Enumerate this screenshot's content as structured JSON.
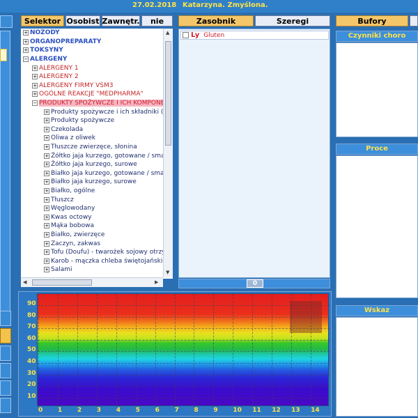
{
  "header": {
    "date": "27.02.2018",
    "user": "Katarzyna. Zmyślona."
  },
  "tabs_left": [
    {
      "label": "Selektor",
      "active": true
    },
    {
      "label": "Osobist",
      "active": false
    },
    {
      "label": "Zawnętr.",
      "active": false
    },
    {
      "label": "nie",
      "active": false
    }
  ],
  "tabs_middle": [
    {
      "label": "Zasobnik",
      "active": true
    },
    {
      "label": "Szeregi",
      "active": false
    }
  ],
  "tabs_right": [
    {
      "label": "Bufory",
      "active": true
    }
  ],
  "tree": [
    {
      "label": "NOZODY",
      "level": 0,
      "style": "blue"
    },
    {
      "label": "ORGANOPREPARATY",
      "level": 0,
      "style": "blue"
    },
    {
      "label": "TOKSYNY",
      "level": 0,
      "style": "blue"
    },
    {
      "label": "ALERGENY",
      "level": 0,
      "style": "blue",
      "expanded": true
    },
    {
      "label": "ALERGENY 1",
      "level": 1,
      "style": "red"
    },
    {
      "label": "ALERGENY 2",
      "level": 1,
      "style": "red"
    },
    {
      "label": "ALERGENY FIRMY VSM3",
      "level": 1,
      "style": "red"
    },
    {
      "label": "OGÓLNE REAKCJE \"MEDPHARMA\"",
      "level": 1,
      "style": "red"
    },
    {
      "label": "PRODUKTY SPOŻYWCZE I ICH KOMPONEN",
      "level": 1,
      "style": "pink",
      "expanded": true
    },
    {
      "label": "Produkty spożywcze i ich składniki (SUMA",
      "level": 2,
      "style": "dark"
    },
    {
      "label": "Produkty spożywcze",
      "level": 2,
      "style": "dark"
    },
    {
      "label": "Czekolada",
      "level": 2,
      "style": "dark"
    },
    {
      "label": "Oliwa z oliwek",
      "level": 2,
      "style": "dark"
    },
    {
      "label": "Tłuszcze zwierzęce, słonina",
      "level": 2,
      "style": "dark"
    },
    {
      "label": "Żółtko jaja kurzego, gotowane / smażone",
      "level": 2,
      "style": "dark"
    },
    {
      "label": "Żółtko jaja kurzego, surowe",
      "level": 2,
      "style": "dark"
    },
    {
      "label": "Białko jaja kurzego, gotowane / smażone",
      "level": 2,
      "style": "dark"
    },
    {
      "label": "Białko jaja kurzego, surowe",
      "level": 2,
      "style": "dark"
    },
    {
      "label": "Białko, ogólne",
      "level": 2,
      "style": "dark"
    },
    {
      "label": "Tłuszcz",
      "level": 2,
      "style": "dark"
    },
    {
      "label": "Węglowodany",
      "level": 2,
      "style": "dark"
    },
    {
      "label": "Kwas octowy",
      "level": 2,
      "style": "dark"
    },
    {
      "label": "Mąka bobowa",
      "level": 2,
      "style": "dark"
    },
    {
      "label": "Białko, zwierzęce",
      "level": 2,
      "style": "dark"
    },
    {
      "label": "Zaczyn, zakwas",
      "level": 2,
      "style": "dark"
    },
    {
      "label": "Tofu (Doufu) - twarożek sojowy otrzymywa",
      "level": 2,
      "style": "dark"
    },
    {
      "label": "Karob - mączka chleba świętojańskiego -",
      "level": 2,
      "style": "dark"
    },
    {
      "label": "Salami",
      "level": 2,
      "style": "dark"
    }
  ],
  "zasobnik": {
    "item_prefix": "Ly",
    "item_label": "Gluten",
    "count": "0"
  },
  "right_headers": [
    "Czynniki choro",
    "Proce",
    "Wskaz"
  ],
  "chart": {
    "yticks": [
      "90",
      "80",
      "70",
      "60",
      "50",
      "40",
      "30",
      "20",
      "10"
    ],
    "xticks": [
      "0",
      "1",
      "2",
      "3",
      "4",
      "5",
      "6",
      "7",
      "8",
      "9",
      "10",
      "11",
      "12",
      "13",
      "14"
    ]
  }
}
